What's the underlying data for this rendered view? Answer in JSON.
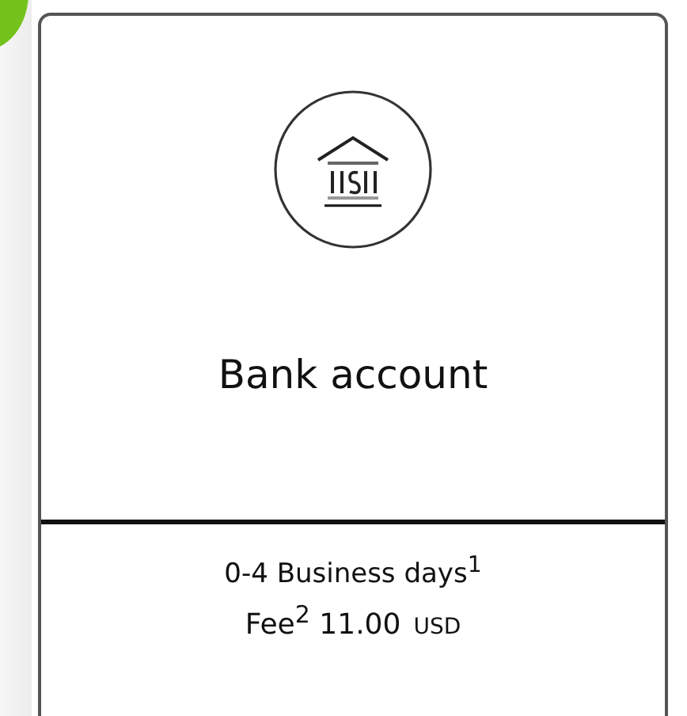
{
  "payment_option": {
    "selected": true,
    "title": "Bank account",
    "delivery": "0-4 Business days$^{1}$",
    "fee": "Fee$^{2}$ 11.00",
    "currency": "USD"
  }
}
